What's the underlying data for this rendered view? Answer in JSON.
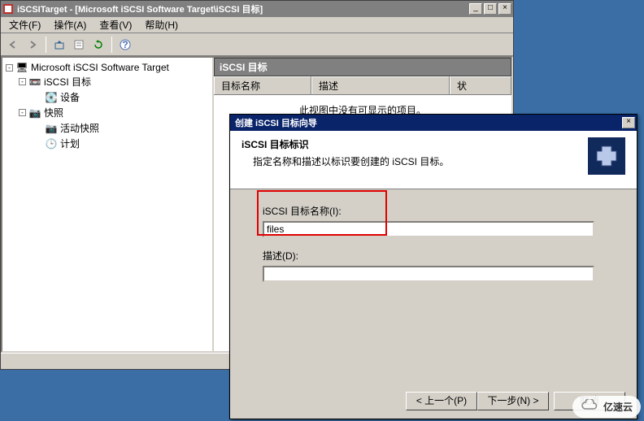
{
  "mmc": {
    "title": "iSCSITarget - [Microsoft iSCSI Software Target\\iSCSI 目标]",
    "win_controls": {
      "min": "_",
      "max": "□",
      "close": "×"
    },
    "menu": {
      "file": "文件(F)",
      "action": "操作(A)",
      "view": "查看(V)",
      "help": "帮助(H)"
    },
    "tree": {
      "root": "Microsoft iSCSI Software Target",
      "targets": "iSCSI 目标",
      "devices": "设备",
      "snapshots": "快照",
      "active_snapshots": "活动快照",
      "schedule": "计划"
    },
    "content": {
      "header": "iSCSI 目标",
      "col_name": "目标名称",
      "col_desc": "描述",
      "col_stat": "状",
      "empty": "此视图中没有可显示的项目。"
    }
  },
  "wizard": {
    "title": "创建 iSCSI 目标向导",
    "close": "×",
    "header_title": "iSCSI 目标标识",
    "header_sub": "指定名称和描述以标识要创建的 iSCSI 目标。",
    "name_label": "iSCSI 目标名称(I):",
    "name_value": "files",
    "desc_label": "描述(D):",
    "desc_value": "",
    "btn_back": "< 上一个(P)",
    "btn_next": "下一步(N) >",
    "btn_cancel": "取消"
  },
  "watermark": "亿速云"
}
